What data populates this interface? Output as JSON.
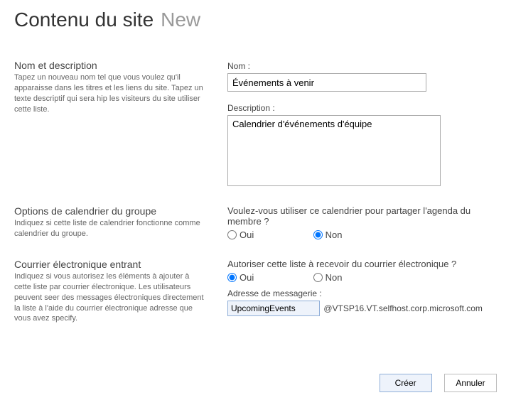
{
  "header": {
    "title": "Contenu du site",
    "subtitle": "New"
  },
  "section1": {
    "title": "Nom et description",
    "help": "Tapez un nouveau nom tel que vous voulez qu'il apparaisse dans les titres et les liens du site. Tapez un texte descriptif qui sera hip les visiteurs du site utiliser cette liste.",
    "name_label": "Nom :",
    "name_value": "Événements à venir",
    "desc_label": "Description :",
    "desc_value": "Calendrier d'événements d'équipe"
  },
  "section2": {
    "title": "Options de calendrier du groupe",
    "help": "Indiquez si cette liste de calendrier fonctionne comme calendrier du groupe.",
    "question": "Voulez-vous utiliser ce calendrier pour partager l'agenda du membre ?",
    "opt_yes": "Oui",
    "opt_no": "Non"
  },
  "section3": {
    "title": "Courrier électronique entrant",
    "help": "Indiquez si vous autorisez les éléments à ajouter à cette liste par courrier électronique. Les utilisateurs peuvent seer des messages électroniques directement la liste à l'aide du courrier électronique adresse que vous avez specify.",
    "question": "Autoriser cette liste à recevoir du courrier électronique ?",
    "opt_yes": "Oui",
    "opt_no": "Non",
    "email_label": "Adresse de messagerie :",
    "email_value": "UpcomingEvents",
    "email_suffix": "@VTSP16.VT.selfhost.corp.microsoft.com"
  },
  "buttons": {
    "create": "Créer",
    "cancel": "Annuler"
  }
}
